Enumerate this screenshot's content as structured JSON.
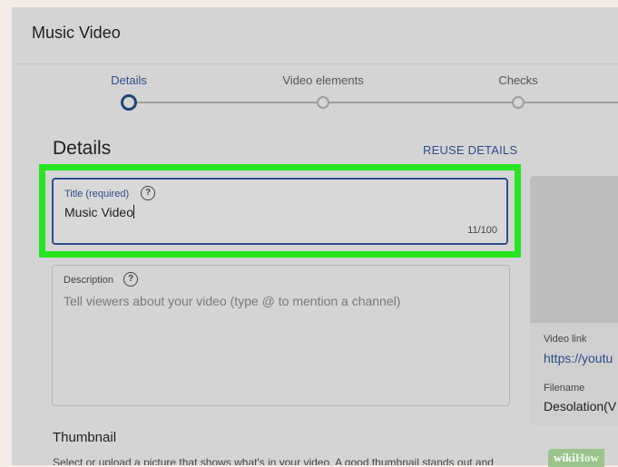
{
  "dialog": {
    "title": "Music Video"
  },
  "stepper": {
    "steps": [
      {
        "label": "Details",
        "active": true
      },
      {
        "label": "Video elements",
        "active": false
      },
      {
        "label": "Checks",
        "active": false
      }
    ]
  },
  "details": {
    "heading": "Details",
    "reuse_label": "REUSE DETAILS",
    "title_field": {
      "label": "Title (required)",
      "help": "?",
      "value": "Music Video",
      "counter": "11/100"
    },
    "description_field": {
      "label": "Description",
      "help": "?",
      "placeholder": "Tell viewers about your video (type @ to mention a channel)"
    },
    "thumbnail": {
      "heading": "Thumbnail",
      "description": "Select or upload a picture that shows what's in your video. A good thumbnail stands out and"
    }
  },
  "side_panel": {
    "video_link_label": "Video link",
    "video_link_value": "https://youtu",
    "filename_label": "Filename",
    "filename_value": "Desolation(V"
  },
  "watermark": {
    "wiki": "wiki",
    "how": "How"
  },
  "colors": {
    "highlight": "#27e520",
    "accent": "#2c4f8a",
    "active_step": "#1d4577"
  }
}
